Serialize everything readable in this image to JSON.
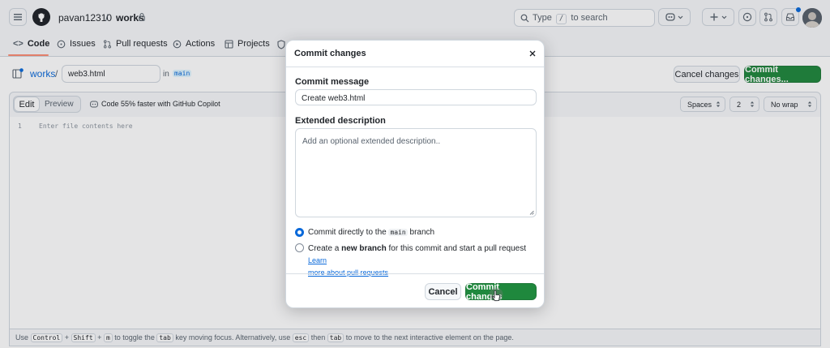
{
  "header": {
    "owner": "pavan12310",
    "separator": "/",
    "repo": "works",
    "search_placeholder_prefix": "Type",
    "search_key": "/",
    "search_placeholder_suffix": "to search"
  },
  "nav": {
    "items": [
      {
        "label": "Code",
        "icon": "code-icon"
      },
      {
        "label": "Issues",
        "icon": "issue-icon"
      },
      {
        "label": "Pull requests",
        "icon": "pull-request-icon"
      },
      {
        "label": "Actions",
        "icon": "play-icon"
      },
      {
        "label": "Projects",
        "icon": "table-icon"
      }
    ]
  },
  "file": {
    "repo_link": "works",
    "separator": "/",
    "filename": "web3.html",
    "in_label": "in",
    "branch": "main",
    "cancel_label": "Cancel changes",
    "commit_label": "Commit changes..."
  },
  "editor_toolbar": {
    "edit_tab": "Edit",
    "preview_tab": "Preview",
    "copilot_text": "Code 55% faster with GitHub Copilot",
    "indent_mode": "Spaces",
    "indent_size": "2",
    "wrap_mode": "No wrap"
  },
  "editor": {
    "line_number": "1",
    "placeholder": "Enter file contents here"
  },
  "statusbar": {
    "use": "Use",
    "key_ctrl": "Control",
    "plus1": "+",
    "key_shift": "Shift",
    "plus2": "+",
    "key_m": "m",
    "text1": "to toggle the",
    "key_tab": "tab",
    "text2": "key moving focus. Alternatively, use",
    "key_esc": "esc",
    "text3": "then",
    "key_tab2": "tab",
    "text4": "to move to the next interactive element on the page."
  },
  "modal": {
    "title": "Commit changes",
    "message_label": "Commit message",
    "message_value": "Create web3.html",
    "description_label": "Extended description",
    "description_placeholder": "Add an optional extended description..",
    "option1_prefix": "Commit directly to the",
    "option1_branch": "main",
    "option1_suffix": "branch",
    "option2_prefix": "Create a",
    "option2_bold": "new branch",
    "option2_suffix": "for this commit and start a pull request",
    "option2_link1": "Learn",
    "option2_link2": "more about pull requests",
    "cancel_label": "Cancel",
    "commit_label": "Commit changes"
  },
  "colors": {
    "accent": "#0969da",
    "primary_green": "#1f883d",
    "nav_underline": "#fd8c73"
  }
}
